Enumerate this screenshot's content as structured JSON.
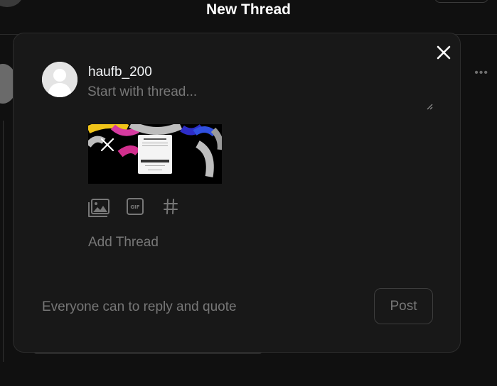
{
  "header": {
    "title": "New Thread"
  },
  "composer": {
    "username": "haufb_200",
    "placeholder": "Start with thread...",
    "add_thread_label": "Add Thread",
    "reply_setting_text": "Everyone can to reply and quote",
    "post_label": "Post"
  },
  "toolbar": {
    "icons": [
      "media-gallery-icon",
      "gif-icon",
      "hashtag-icon"
    ]
  },
  "colors": {
    "background": "#101010",
    "modal": "#181818",
    "text": "#f3f5f7",
    "muted": "#777777",
    "border": "#3d3d3d"
  }
}
